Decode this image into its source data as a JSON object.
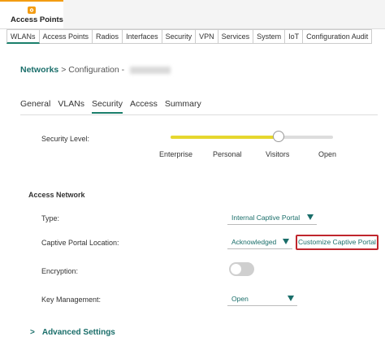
{
  "header": {
    "title": "Access Points",
    "icon": "access-point-icon"
  },
  "subnav": {
    "items": [
      "WLANs",
      "Access Points",
      "Radios",
      "Interfaces",
      "Security",
      "VPN",
      "Services",
      "System",
      "IoT",
      "Configuration Audit"
    ],
    "active": "WLANs"
  },
  "breadcrumb": {
    "networks": "Networks",
    "separator": ">",
    "configuration": "Configuration -"
  },
  "tabs": {
    "items": [
      "General",
      "VLANs",
      "Security",
      "Access",
      "Summary"
    ],
    "active": "Security"
  },
  "security_level": {
    "label": "Security Level:",
    "levels": [
      "Enterprise",
      "Personal",
      "Visitors",
      "Open"
    ],
    "selected": "Visitors"
  },
  "access_network": {
    "title": "Access Network",
    "type_label": "Type:",
    "type_value": "Internal Captive Portal",
    "location_label": "Captive Portal Location:",
    "location_value": "Acknowledged",
    "customize_link": "Customize Captive Portal",
    "encryption_label": "Encryption:",
    "encryption_enabled": false,
    "key_label": "Key Management:",
    "key_value": "Open"
  },
  "advanced": {
    "label": "Advanced Settings",
    "chevron": ">"
  },
  "colors": {
    "accent": "#1a6e6a",
    "slider": "#e6d72e",
    "highlight": "#c0262d",
    "tab_orange": "#f39c12"
  }
}
